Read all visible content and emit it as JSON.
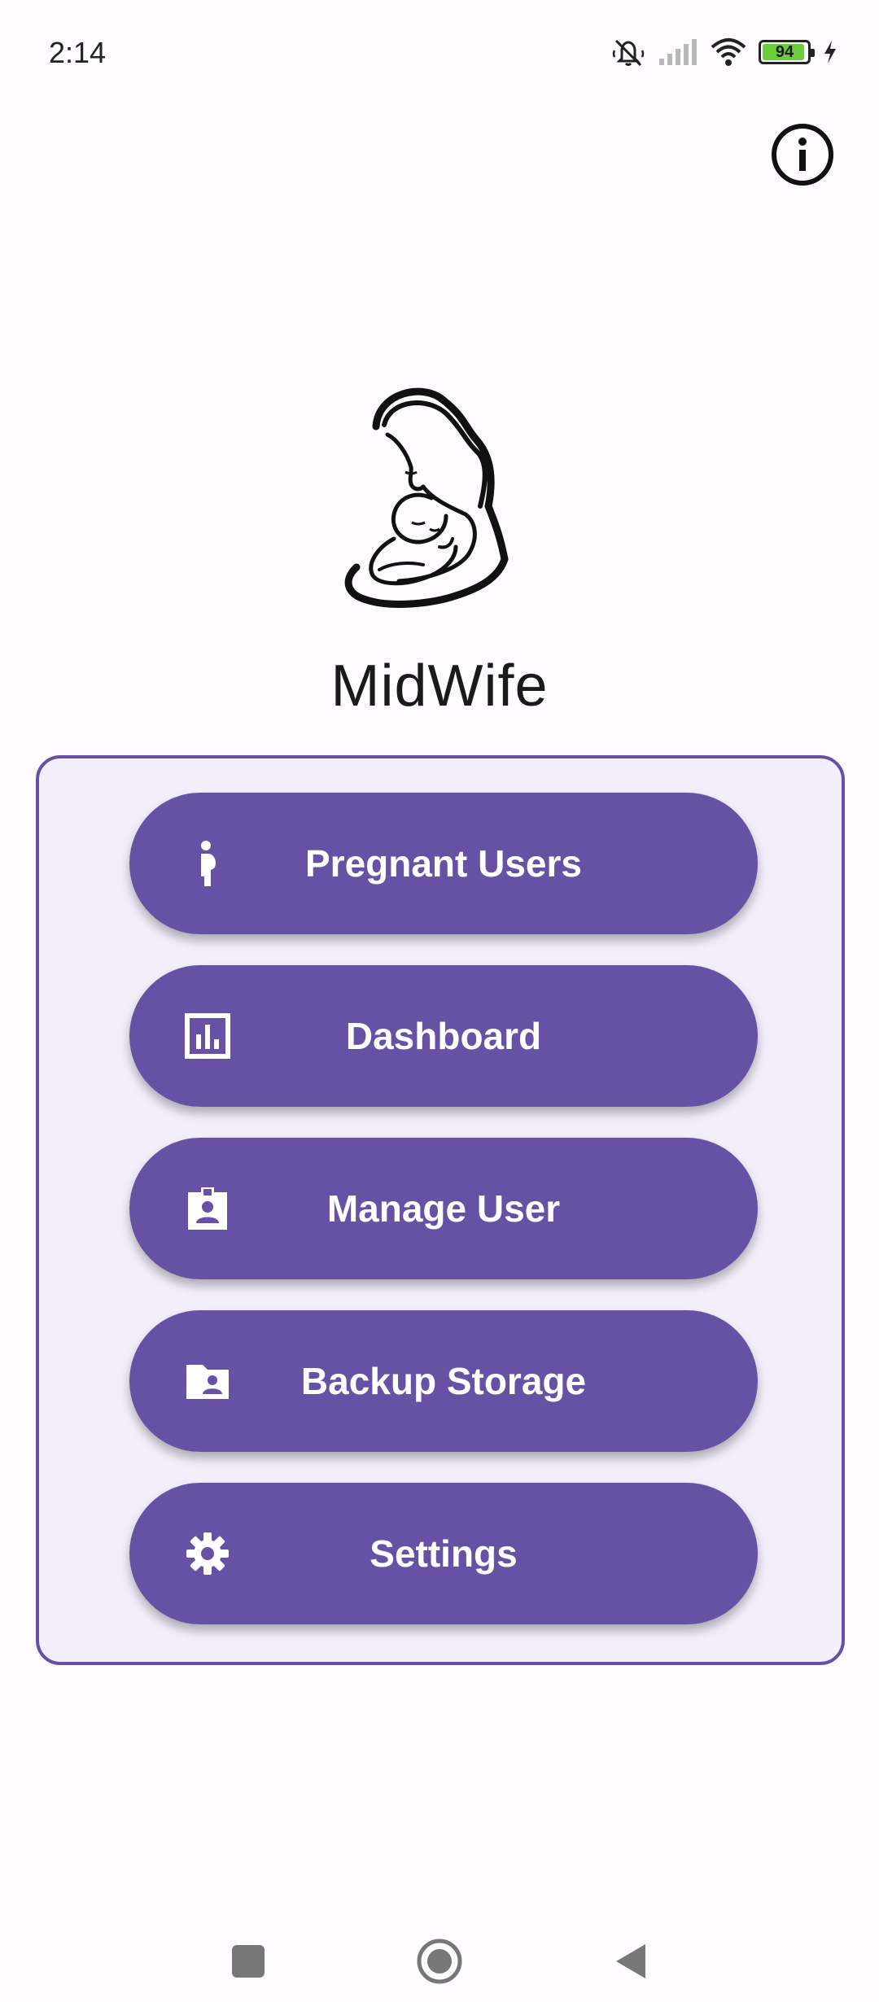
{
  "status_bar": {
    "time": "2:14",
    "battery_level": "94",
    "battery_fraction": 0.94,
    "icons": [
      "silent-mode-icon",
      "signal-icon",
      "wifi-icon",
      "battery-icon",
      "charging-icon"
    ]
  },
  "header": {
    "info_icon": "info-icon"
  },
  "app": {
    "title": "MidWife",
    "logo": "mother-baby-logo"
  },
  "menu": {
    "items": [
      {
        "label": "Pregnant Users",
        "icon": "pregnant-woman-icon"
      },
      {
        "label": "Dashboard",
        "icon": "bar-chart-icon"
      },
      {
        "label": "Manage User",
        "icon": "badge-icon"
      },
      {
        "label": "Backup Storage",
        "icon": "user-folder-icon"
      },
      {
        "label": "Settings",
        "icon": "gear-icon"
      }
    ]
  },
  "colors": {
    "accent": "#6751a4",
    "card_background": "#f2eefa",
    "button_text": "#ffffff"
  },
  "nav_bar": {
    "items": [
      "recents-button",
      "home-button",
      "back-button"
    ]
  }
}
